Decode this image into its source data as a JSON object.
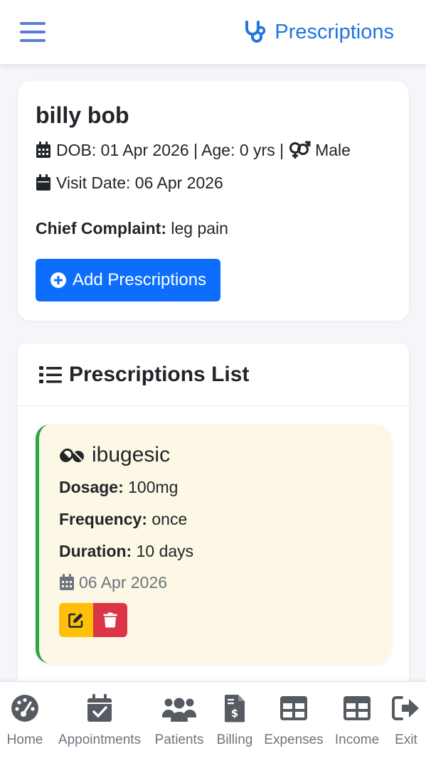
{
  "header": {
    "menu_icon": "hamburger-icon",
    "brand_icon": "stethoscope-icon",
    "title": "Prescriptions"
  },
  "patient": {
    "name": "billy bob",
    "dob_label": "DOB: 01 Apr 2026 | Age: 0 yrs |",
    "gender": "Male",
    "visit_label": "Visit Date: 06 Apr 2026",
    "complaint_label": "Chief Complaint:",
    "complaint_value": "leg pain",
    "add_button": "Add Prescriptions"
  },
  "list": {
    "title": "Prescriptions List",
    "items": [
      {
        "name": "ibugesic",
        "dosage_label": "Dosage:",
        "dosage": "100mg",
        "frequency_label": "Frequency:",
        "frequency": "once",
        "duration_label": "Duration:",
        "duration": "10 days",
        "date": "06 Apr 2026"
      }
    ]
  },
  "bottom_nav": [
    {
      "label": "Home",
      "icon": "dashboard-gauge-icon"
    },
    {
      "label": "Appointments",
      "icon": "calendar-check-icon"
    },
    {
      "label": "Patients",
      "icon": "users-icon"
    },
    {
      "label": "Billing",
      "icon": "invoice-dollar-icon"
    },
    {
      "label": "Expenses",
      "icon": "table-icon"
    },
    {
      "label": "Income",
      "icon": "table-icon"
    },
    {
      "label": "Exit",
      "icon": "sign-out-icon"
    }
  ],
  "colors": {
    "primary": "#0d6efd",
    "brand": "#1f75e0",
    "accent_border": "#28a745",
    "edit": "#ffc107",
    "delete": "#dc3545",
    "rx_background": "#fdf8e6"
  }
}
